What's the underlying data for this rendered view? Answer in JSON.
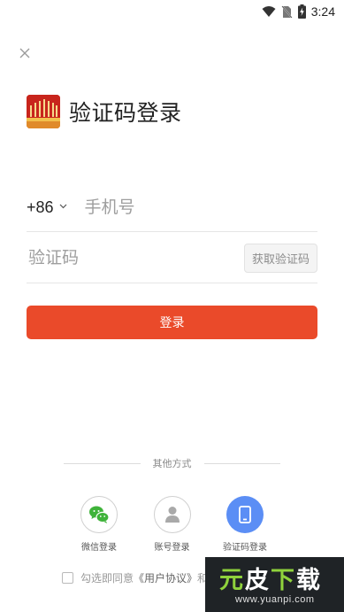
{
  "status_bar": {
    "time": "3:24",
    "icons": [
      "wifi-icon",
      "no-sim-icon",
      "battery-charging-icon"
    ]
  },
  "close_icon": "close-icon",
  "title": "验证码登录",
  "phone": {
    "country_code": "+86",
    "placeholder": "手机号",
    "value": ""
  },
  "code": {
    "placeholder": "验证码",
    "value": "",
    "get_code_label": "获取验证码"
  },
  "login_button": "登录",
  "other_methods": {
    "title": "其他方式",
    "items": [
      {
        "label": "微信登录",
        "icon": "wechat-icon"
      },
      {
        "label": "账号登录",
        "icon": "user-icon"
      },
      {
        "label": "验证码登录",
        "icon": "phone-icon"
      }
    ]
  },
  "agreement": {
    "prefix": "勾选即同意",
    "link": "《用户协议》",
    "suffix": "和"
  },
  "watermark": {
    "chars": [
      "元",
      "皮",
      "下",
      "载"
    ],
    "url": "www.yuanpi.com"
  },
  "colors": {
    "accent": "#ea4a2a",
    "method_active": "#5b8ef5",
    "logo": "#c8251c"
  }
}
